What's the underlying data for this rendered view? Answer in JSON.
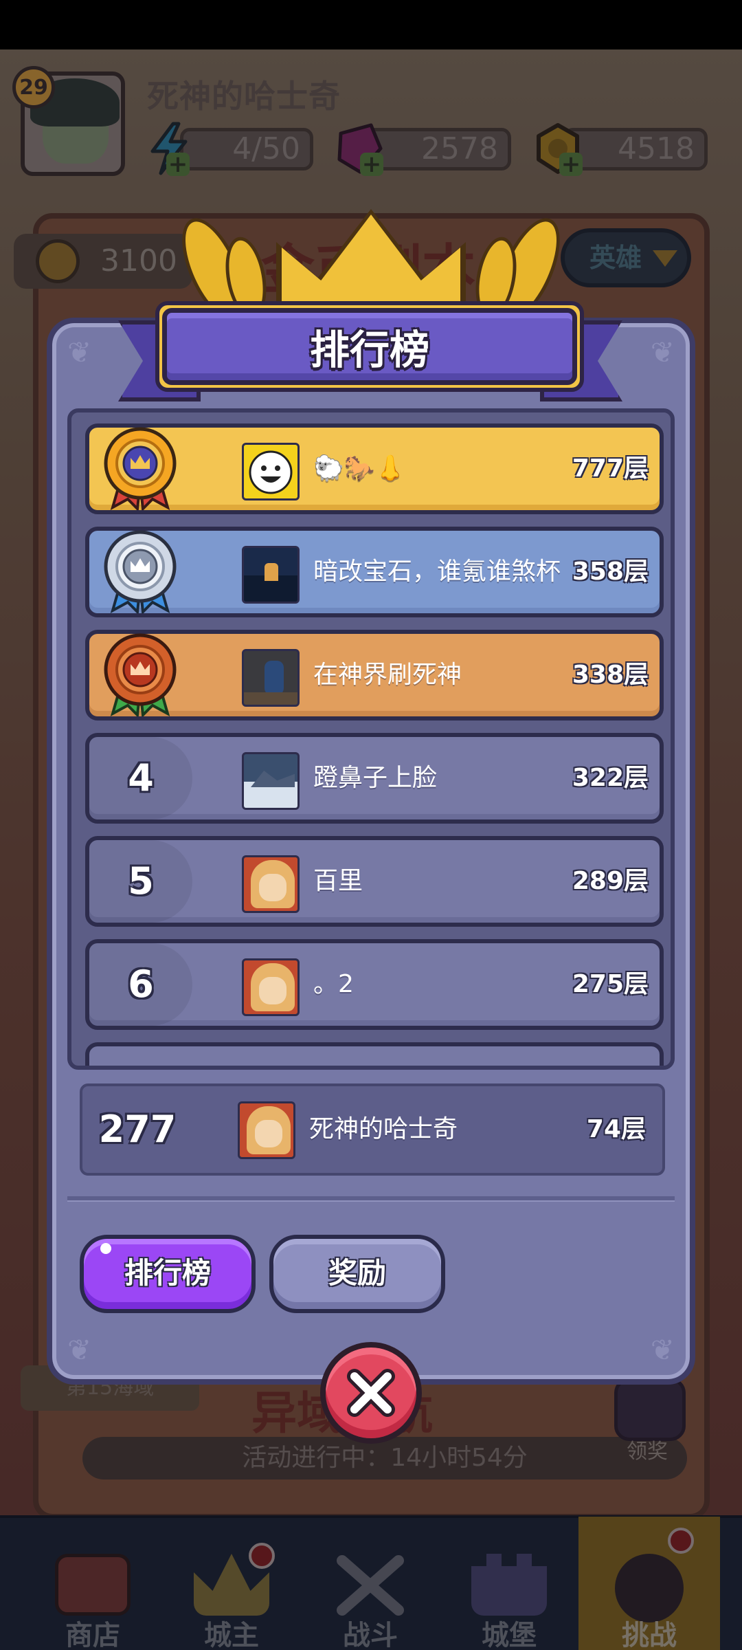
{
  "player": {
    "level": "29",
    "name": "死神的哈士奇",
    "energy": "4/50",
    "gems": "2578",
    "gold": "4518"
  },
  "background": {
    "coins": "3100",
    "hero_dropdown": "英雄",
    "title_fragment": "金币副本",
    "sea_area": "第15海域",
    "event_title": "异域征航",
    "activity_status": "活动进行中：14小时54分",
    "claim_label": "领奖"
  },
  "leaderboard": {
    "title": "排行榜",
    "rows": [
      {
        "rank": "1",
        "name": "🐑🐎👃",
        "score": "777层",
        "medal": "gold"
      },
      {
        "rank": "2",
        "name": "暗改宝石，谁氪谁煞杯",
        "score": "358层",
        "medal": "silver"
      },
      {
        "rank": "3",
        "name": "在神界刷死神",
        "score": "338层",
        "medal": "bronze"
      },
      {
        "rank": "4",
        "name": "蹬鼻子上脸",
        "score": "322层"
      },
      {
        "rank": "5",
        "name": "百里",
        "score": "289层"
      },
      {
        "rank": "6",
        "name": "。2",
        "score": "275层"
      }
    ],
    "self": {
      "rank": "277",
      "name": "死神的哈士奇",
      "score": "74层"
    },
    "tabs": {
      "rank": "排行榜",
      "reward": "奖励"
    }
  },
  "nav": {
    "shop": "商店",
    "lord": "城主",
    "battle": "战斗",
    "castle": "城堡",
    "challenge": "挑战"
  },
  "colors": {
    "gold_row": "#f3c552",
    "silver_row": "#7d99cf",
    "bronze_row": "#e19e5d",
    "plain_row": "#7779a5",
    "modal": "#7678a6",
    "ribbon": "#6a5ac4",
    "active_tab": "#9b47f5",
    "close_button": "#e2485f"
  },
  "icons": [
    "lightning-icon",
    "gem-icon",
    "coin-icon",
    "close-icon",
    "crown-icon",
    "laurel-icon",
    "medal-icon",
    "chest-icon"
  ]
}
